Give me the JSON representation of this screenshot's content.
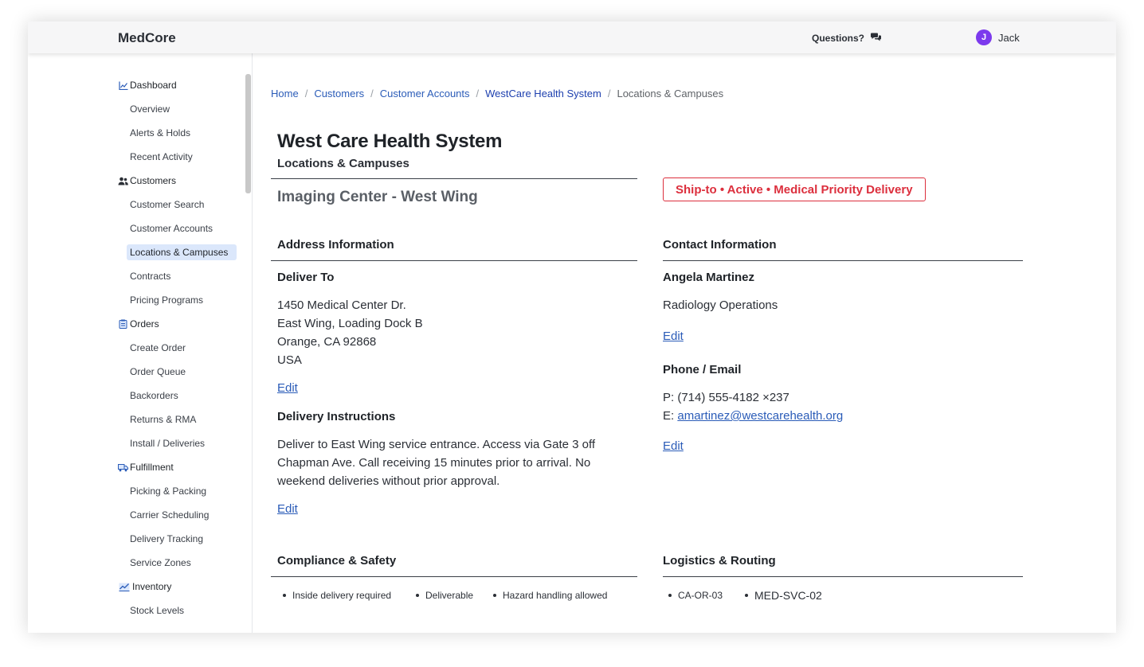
{
  "header": {
    "logo": "MedCore",
    "questions_label": "Questions?",
    "user_initial": "J",
    "user_name": "Jack"
  },
  "sidebar": {
    "sections": [
      {
        "label": "Dashboard",
        "icon": "chart-icon",
        "items": [
          "Overview",
          "Alerts & Holds",
          "Recent Activity"
        ]
      },
      {
        "label": "Customers",
        "icon": "users-icon",
        "items": [
          "Customer Search",
          "Customer Accounts",
          "Locations & Campuses",
          "Contracts",
          "Pricing Programs"
        ]
      },
      {
        "label": "Orders",
        "icon": "clipboard-icon",
        "items": [
          "Create Order",
          "Order Queue",
          "Backorders",
          "Returns & RMA",
          "Install / Deliveries"
        ]
      },
      {
        "label": "Fulfillment",
        "icon": "truck-icon",
        "items": [
          "Picking & Packing",
          "Carrier Scheduling",
          "Delivery Tracking",
          "Service Zones"
        ]
      },
      {
        "label": "Inventory",
        "icon": "trend-icon",
        "items": [
          "Stock Levels"
        ]
      }
    ],
    "active_item": "Locations & Campuses"
  },
  "breadcrumb": {
    "items": [
      "Home",
      "Customers",
      "Customer Accounts",
      "WestCare Health System"
    ],
    "current": "Locations & Campuses"
  },
  "page": {
    "title": "West Care Health System",
    "subtitle": "Locations & Campuses",
    "location_name": "Imaging Center - West Wing",
    "status_badge": "Ship-to • Active • Medical Priority Delivery",
    "badge_color": "#dc2f3d"
  },
  "address": {
    "heading": "Address Information",
    "deliver_to_label": "Deliver To",
    "lines": [
      "1450 Medical Center Dr.",
      "East Wing, Loading Dock B",
      "Orange, CA 92868",
      "USA"
    ],
    "edit_label": "Edit",
    "instructions_label": "Delivery Instructions",
    "instructions": "Deliver to East Wing service entrance. Access via Gate 3 off Chapman Ave. Call receiving 15 minutes prior to arrival. No weekend deliveries without prior approval.",
    "instructions_edit_label": "Edit"
  },
  "contact": {
    "heading": "Contact Information",
    "name": "Angela Martinez",
    "department": "Radiology Operations",
    "edit_label": "Edit",
    "phone_email_label": "Phone / Email",
    "phone": "P: (714) 555-4182 ×237",
    "email_prefix": "E:",
    "email": "amartinez@westcarehealth.org",
    "phone_edit_label": "Edit"
  },
  "compliance": {
    "heading": "Compliance & Safety",
    "items": [
      "Inside delivery required",
      "Deliverable",
      "Hazard handling allowed"
    ]
  },
  "logistics": {
    "heading": "Logistics & Routing",
    "items": [
      "CA-OR-03",
      "MED-SVC-02"
    ]
  }
}
